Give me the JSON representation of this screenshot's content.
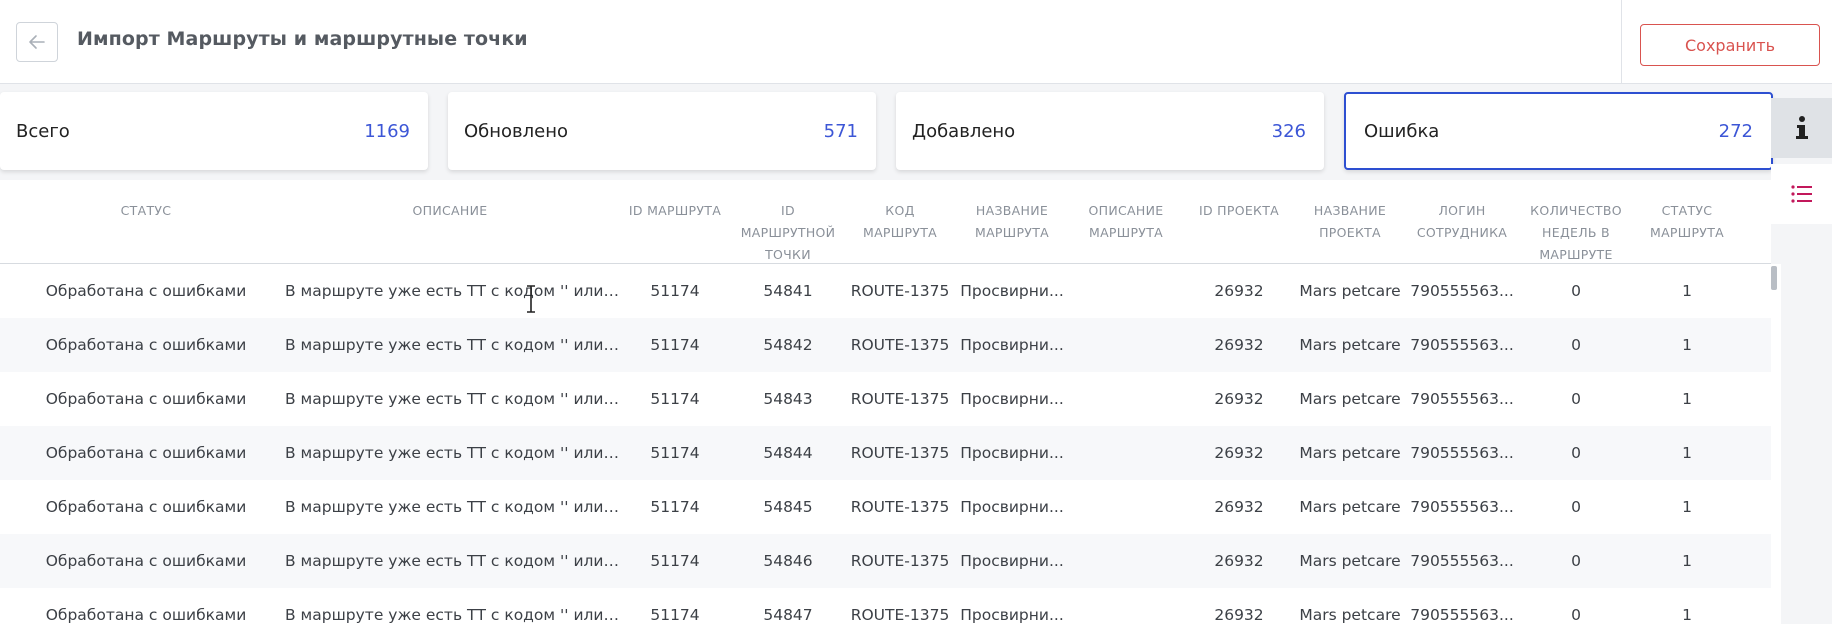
{
  "header": {
    "title": "Импорт Маршруты и маршрутные точки",
    "save_label": "Сохранить"
  },
  "stats": [
    {
      "label": "Всего",
      "value": "1169"
    },
    {
      "label": "Обновлено",
      "value": "571"
    },
    {
      "label": "Добавлено",
      "value": "326"
    },
    {
      "label": "Ошибка",
      "value": "272"
    }
  ],
  "table": {
    "columns": [
      "Статус",
      "Описание",
      "ID маршрута",
      "ID маршрутной точки",
      "Код маршрута",
      "Название маршрута",
      "Описание маршрута",
      "ID проекта",
      "Название проекта",
      "Логин сотрудника",
      "Количество недель в маршруте",
      "Статус маршрута"
    ],
    "rows": [
      [
        "Обработана с ошибками",
        "В маршруте уже есть ТТ с кодом '' или к...",
        "51174",
        "54841",
        "ROUTE-1375",
        "Просвирни...",
        "",
        "26932",
        "Mars petcare",
        "790555563...",
        "0",
        "1"
      ],
      [
        "Обработана с ошибками",
        "В маршруте уже есть ТТ с кодом '' или к...",
        "51174",
        "54842",
        "ROUTE-1375",
        "Просвирни...",
        "",
        "26932",
        "Mars petcare",
        "790555563...",
        "0",
        "1"
      ],
      [
        "Обработана с ошибками",
        "В маршруте уже есть ТТ с кодом '' или к...",
        "51174",
        "54843",
        "ROUTE-1375",
        "Просвирни...",
        "",
        "26932",
        "Mars petcare",
        "790555563...",
        "0",
        "1"
      ],
      [
        "Обработана с ошибками",
        "В маршруте уже есть ТТ с кодом '' или к...",
        "51174",
        "54844",
        "ROUTE-1375",
        "Просвирни...",
        "",
        "26932",
        "Mars petcare",
        "790555563...",
        "0",
        "1"
      ],
      [
        "Обработана с ошибками",
        "В маршруте уже есть ТТ с кодом '' или к...",
        "51174",
        "54845",
        "ROUTE-1375",
        "Просвирни...",
        "",
        "26932",
        "Mars petcare",
        "790555563...",
        "0",
        "1"
      ],
      [
        "Обработана с ошибками",
        "В маршруте уже есть ТТ с кодом '' или к...",
        "51174",
        "54846",
        "ROUTE-1375",
        "Просвирни...",
        "",
        "26932",
        "Mars petcare",
        "790555563...",
        "0",
        "1"
      ],
      [
        "Обработана с ошибками",
        "В маршруте уже есть ТТ с кодом '' или к...",
        "51174",
        "54847",
        "ROUTE-1375",
        "Просвирни...",
        "",
        "26932",
        "Mars petcare",
        "790555563...",
        "0",
        "1"
      ]
    ]
  },
  "icons": {
    "back": "arrow-left-icon",
    "info": "info-icon",
    "list": "list-icon"
  },
  "colors": {
    "accent": "#2d4fd1",
    "count": "#3c56d6",
    "danger": "#d9534f",
    "list_icon": "#c2185b"
  }
}
